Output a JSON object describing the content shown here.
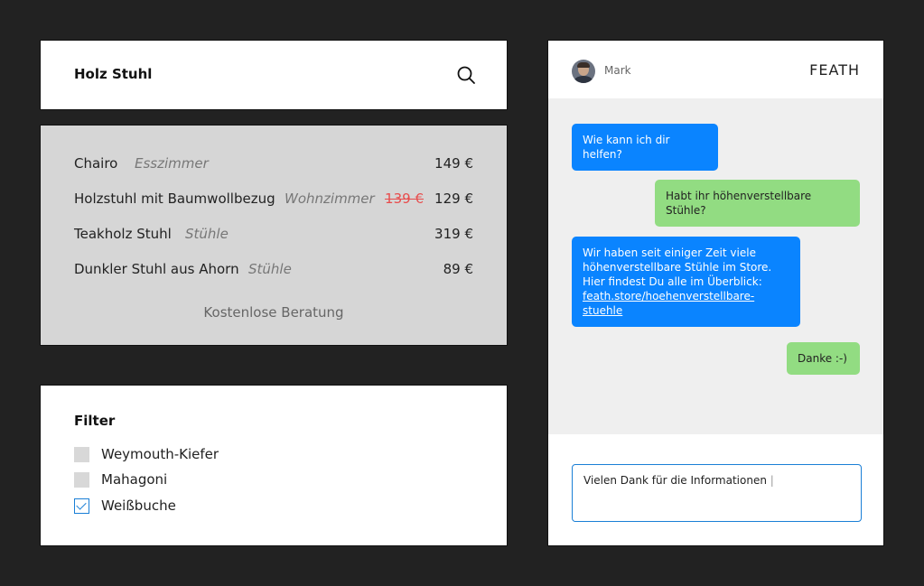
{
  "search": {
    "query": "Holz Stuhl"
  },
  "results": {
    "items": [
      {
        "name": "Chairo",
        "category": "Esszimmer",
        "old_price": "",
        "price": "149 €"
      },
      {
        "name": "Holzstuhl mit Baumwollbezug",
        "category": "Wohnzimmer",
        "old_price": "139 €",
        "price": "129 €"
      },
      {
        "name": "Teakholz Stuhl",
        "category": "Stühle",
        "old_price": "",
        "price": "319 €"
      },
      {
        "name": "Dunkler Stuhl aus Ahorn",
        "category": "Stühle",
        "old_price": "",
        "price": "89 €"
      }
    ],
    "consult_label": "Kostenlose Beratung"
  },
  "filter": {
    "title": "Filter",
    "options": [
      {
        "label": "Weymouth-Kiefer",
        "checked": false
      },
      {
        "label": "Mahagoni",
        "checked": false
      },
      {
        "label": "Weißbuche",
        "checked": true
      }
    ]
  },
  "chat": {
    "agent_name": "Mark",
    "brand": "FEATH",
    "messages": [
      {
        "from": "agent",
        "text": "Wie kann ich dir helfen?"
      },
      {
        "from": "user",
        "text": "Habt ihr höhenverstellbare Stühle?"
      },
      {
        "from": "agent",
        "text": "Wir haben seit einiger Zeit viele höhenverstellbare Stühle im Store. Hier findest Du alle im Überblick:",
        "link": "feath.store/hoehenverstellbare-stuehle"
      },
      {
        "from": "user",
        "text": "Danke :-)"
      }
    ],
    "input_value": "Vielen Dank für die Informationen"
  },
  "colors": {
    "background": "#222222",
    "agent_bubble": "#0a84ff",
    "user_bubble": "#92dc82",
    "strike_price": "#e84c4c",
    "accent": "#1a7fd6"
  },
  "icons": {
    "search": "search-icon",
    "avatar": "avatar",
    "check": "check-icon"
  }
}
